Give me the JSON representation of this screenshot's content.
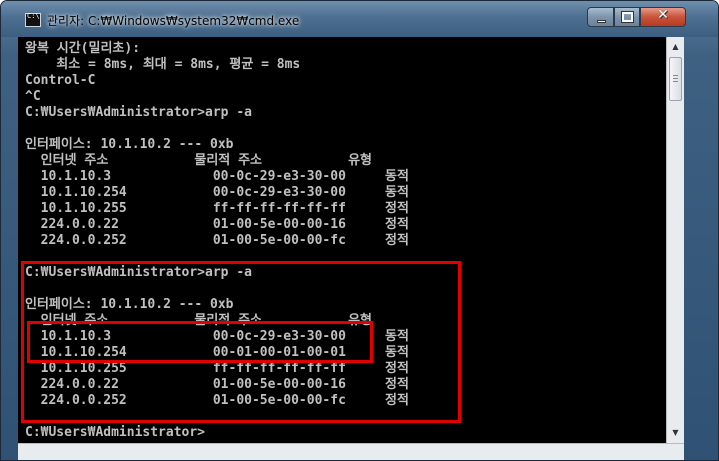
{
  "window": {
    "title": "관리자: C:₩Windows₩system32₩cmd.exe",
    "icon": "cmd-icon",
    "buttons": {
      "minimize": "minimize-icon",
      "maximize": "maximize-icon",
      "close": "✕"
    }
  },
  "console": {
    "lines": [
      "왕복 시간(밀리초):",
      "    최소 = 8ms, 최대 = 8ms, 평균 = 8ms",
      "Control-C",
      "^C",
      "C:₩Users₩Administrator>arp -a",
      "",
      "인터페이스: 10.1.10.2 --- 0xb",
      "  인터넷 주소           물리적 주소           유형",
      "  10.1.10.3             00-0c-29-e3-30-00     동적",
      "  10.1.10.254           00-0c-29-e3-30-00     동적",
      "  10.1.10.255           ff-ff-ff-ff-ff-ff     정적",
      "  224.0.0.22            01-00-5e-00-00-16     정적",
      "  224.0.0.252           01-00-5e-00-00-fc     정적",
      "",
      "C:₩Users₩Administrator>arp -a",
      "",
      "인터페이스: 10.1.10.2 --- 0xb",
      "  인터넷 주소           물리적 주소           유형",
      "  10.1.10.3             00-0c-29-e3-30-00     동적",
      "  10.1.10.254           00-01-00-01-00-01     동적",
      "  10.1.10.255           ff-ff-ff-ff-ff-ff     정적",
      "  224.0.0.22            01-00-5e-00-00-16     정적",
      "  224.0.0.252           01-00-5e-00-00-fc     정적",
      "",
      "C:₩Users₩Administrator>"
    ]
  },
  "colors": {
    "console_bg": "#000000",
    "console_fg": "#c0c0c0",
    "highlight": "#e00000"
  }
}
